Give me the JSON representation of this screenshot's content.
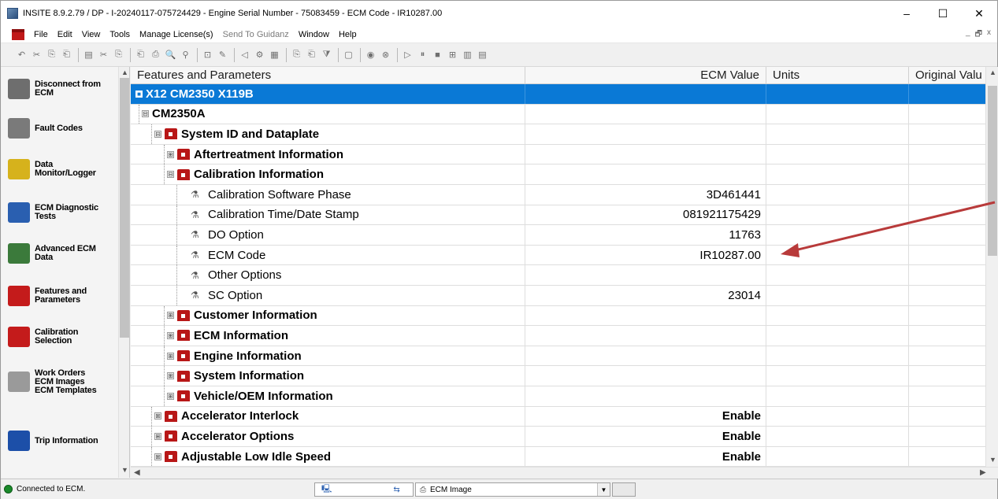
{
  "window": {
    "title": "INSITE 8.9.2.79 / DP - I-20240117-075724429 - Engine Serial Number - 75083459 - ECM Code - IR10287.00",
    "controls": {
      "minimize": "–",
      "maximize": "☐",
      "close": "✕"
    }
  },
  "menu": {
    "items": [
      "File",
      "Edit",
      "View",
      "Tools",
      "Manage License(s)",
      "Send To Guidanz",
      "Window",
      "Help"
    ],
    "disabled": [
      "Send To Guidanz"
    ],
    "mdi": {
      "minimize": "_",
      "restore": "🗗",
      "close": "x"
    }
  },
  "toolbar": {
    "buttons": [
      "↶",
      "✂",
      "⎘",
      "⎗",
      "▤",
      "✂",
      "⎘",
      "⎗",
      "⎙",
      "🔍",
      "⚲",
      "⊡",
      "✎",
      "◁",
      "⚙",
      "▦",
      "⎘",
      "⎗",
      "⧩",
      "▢",
      "◉",
      "⊗",
      "▷",
      "⏸",
      "■",
      "⊞",
      "▥",
      "▤"
    ]
  },
  "leftnav": {
    "items": [
      {
        "label": "Disconnect from\nECM",
        "icon": "disconnect-icon",
        "color": "#6e6e6e"
      },
      {
        "label": "Fault Codes",
        "icon": "fault-codes-icon",
        "color": "#7a7a7a"
      },
      {
        "label": "Data\nMonitor/Logger",
        "icon": "data-monitor-icon",
        "color": "#d6b21c"
      },
      {
        "label": "ECM Diagnostic\nTests",
        "icon": "diagnostic-tests-icon",
        "color": "#2a5fb0"
      },
      {
        "label": "Advanced ECM\nData",
        "icon": "advanced-data-icon",
        "color": "#3b7a3b"
      },
      {
        "label": "Features and\nParameters",
        "icon": "features-parameters-icon",
        "color": "#c41b1b"
      },
      {
        "label": "Calibration\nSelection",
        "icon": "calibration-icon",
        "color": "#c41b1b"
      },
      {
        "label": "Work Orders\nECM Images\nECM Templates",
        "icon": "work-orders-icon",
        "color": "#9a9a9a"
      },
      {
        "label": "Trip Information",
        "icon": "trip-info-icon",
        "color": "#1c4fa8"
      }
    ]
  },
  "grid": {
    "headers": [
      "Features and Parameters",
      "ECM Value",
      "Units",
      "Original Valu"
    ],
    "rows": [
      {
        "label": "X12 CM2350 X119B",
        "value": "",
        "level": 0,
        "toggle": "■",
        "icon": "none",
        "bold": true,
        "selected": true
      },
      {
        "label": "CM2350A",
        "value": "",
        "level": 1,
        "toggle": "⊟",
        "icon": "none",
        "bold": true
      },
      {
        "label": "System ID and Dataplate",
        "value": "",
        "level": 2,
        "toggle": "⊟",
        "icon": "lock",
        "bold": true
      },
      {
        "label": "Aftertreatment Information",
        "value": "",
        "level": 3,
        "toggle": "⊞",
        "icon": "lock",
        "bold": true
      },
      {
        "label": "Calibration Information",
        "value": "",
        "level": 3,
        "toggle": "⊟",
        "icon": "lock",
        "bold": true
      },
      {
        "label": "Calibration Software Phase",
        "value": "3D461441",
        "level": 4,
        "toggle": "",
        "icon": "param",
        "bold": false
      },
      {
        "label": "Calibration Time/Date Stamp",
        "value": "081921175429",
        "level": 4,
        "toggle": "",
        "icon": "param",
        "bold": false
      },
      {
        "label": "DO Option",
        "value": "11763",
        "level": 4,
        "toggle": "",
        "icon": "param",
        "bold": false
      },
      {
        "label": "ECM Code",
        "value": "IR10287.00",
        "level": 4,
        "toggle": "",
        "icon": "param",
        "bold": false
      },
      {
        "label": "Other Options",
        "value": "",
        "level": 4,
        "toggle": "",
        "icon": "param",
        "bold": false
      },
      {
        "label": "SC Option",
        "value": "23014",
        "level": 4,
        "toggle": "",
        "icon": "param",
        "bold": false
      },
      {
        "label": "Customer Information",
        "value": "",
        "level": 3,
        "toggle": "⊞",
        "icon": "lock",
        "bold": true
      },
      {
        "label": "ECM Information",
        "value": "",
        "level": 3,
        "toggle": "⊞",
        "icon": "lock",
        "bold": true
      },
      {
        "label": "Engine Information",
        "value": "",
        "level": 3,
        "toggle": "⊞",
        "icon": "lock",
        "bold": true
      },
      {
        "label": "System Information",
        "value": "",
        "level": 3,
        "toggle": "⊞",
        "icon": "lock",
        "bold": true
      },
      {
        "label": "Vehicle/OEM Information",
        "value": "",
        "level": 3,
        "toggle": "⊞",
        "icon": "lock",
        "bold": true
      },
      {
        "label": "Accelerator Interlock",
        "value": "Enable",
        "level": 2,
        "toggle": "⊞",
        "icon": "lock",
        "bold": true
      },
      {
        "label": "Accelerator Options",
        "value": "Enable",
        "level": 2,
        "toggle": "⊞",
        "icon": "lock",
        "bold": true
      },
      {
        "label": "Adjustable Low Idle Speed",
        "value": "Enable",
        "level": 2,
        "toggle": "⊞",
        "icon": "lock",
        "bold": true
      }
    ]
  },
  "status": {
    "connection": "Connected to ECM.",
    "image_combo": "ECM Image",
    "connection_color": "#1a8a2a"
  },
  "colors": {
    "selection": "#0a79d6",
    "annotation_arrow": "#b83a3a",
    "lock_red": "#b81717"
  }
}
